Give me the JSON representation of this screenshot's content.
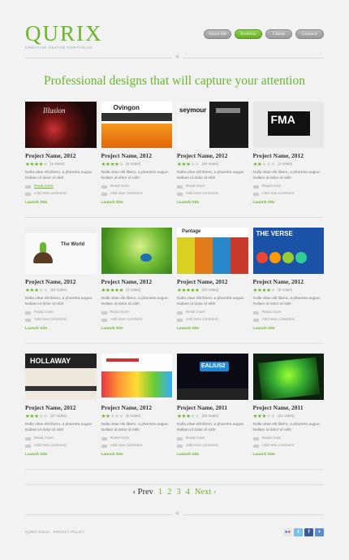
{
  "logo": {
    "name": "QURIX",
    "tagline": "CREATIVE DESIGN PORTFOLIO"
  },
  "nav": [
    {
      "label": "About Me",
      "active": false,
      "w": 34
    },
    {
      "label": "Portfolio",
      "active": true,
      "w": 34
    },
    {
      "label": "Clients",
      "active": false,
      "w": 33
    },
    {
      "label": "Contacts",
      "active": false,
      "w": 35
    }
  ],
  "headline": "Professional designs that will capture your attention",
  "projects": [
    {
      "title": "Project Name, 2012",
      "stars": 4,
      "votes": "(4 Votes)",
      "desc": "Nulla vitae elit libero, a pharetra augue. Nullam id dolor id nibh",
      "read_more": "Read more",
      "comment": "Add new comment",
      "launch": "Launch Site",
      "thumb_text": "Illusion"
    },
    {
      "title": "Project Name, 2012",
      "stars": 4,
      "votes": "(6 Votes)",
      "desc": "Nulla vitae elit libero, a pharetra augue. Nullam id dolor id nibh",
      "read_more": "Read more",
      "comment": "Add new comment",
      "launch": "Launch Site",
      "thumb_text": "Ovingon"
    },
    {
      "title": "Project Name, 2012",
      "stars": 3,
      "votes": "(39 Votes)",
      "desc": "Nulla vitae elit libero, a pharetra augue. Nullam id dolor id nibh",
      "read_more": "Read more",
      "comment": "Add new comment",
      "launch": "Launch Site",
      "thumb_text": "seymour"
    },
    {
      "title": "Project Name, 2012",
      "stars": 2,
      "votes": "(4 Votes)",
      "desc": "Nulla vitae elit libero, a pharetra augue. Nullam id dolor id nibh",
      "read_more": "Read more",
      "comment": "Add new comment",
      "launch": "Launch Site",
      "thumb_text": "FMA"
    },
    {
      "title": "Project Name, 2012",
      "stars": 3,
      "votes": "(44 Votes)",
      "desc": "Nulla vitae elit libero, a pharetra augue. Nullam id dolor id nibh",
      "read_more": "Read more",
      "comment": "Add new comment",
      "launch": "Launch Site",
      "thumb_text": "The World"
    },
    {
      "title": "Project Name, 2012",
      "stars": 5,
      "votes": "(4 Votes)",
      "desc": "Nulla vitae elit libero, a pharetra augue. Nullam id dolor id nibh",
      "read_more": "Read more",
      "comment": "Add new comment",
      "launch": "Launch Site",
      "thumb_text": ""
    },
    {
      "title": "Project Name, 2012",
      "stars": 5,
      "votes": "(23 Votes)",
      "desc": "Nulla vitae elit libero, a pharetra augue. Nullam id dolor id nibh",
      "read_more": "Read more",
      "comment": "Add new comment",
      "launch": "Launch Site",
      "thumb_text": "Pantage"
    },
    {
      "title": "Project Name, 2012",
      "stars": 4,
      "votes": "(5 Votes)",
      "desc": "Nulla vitae elit libero, a pharetra augue. Nullam id dolor id nibh",
      "read_more": "Read more",
      "comment": "Add new comment",
      "launch": "Launch Site",
      "thumb_text": "THE VERSE"
    },
    {
      "title": "Project Name, 2012",
      "stars": 3,
      "votes": "(37 Votes)",
      "desc": "Nulla vitae elit libero, a pharetra augue. Nullam id dolor id nibh",
      "read_more": "Read more",
      "comment": "Add new comment",
      "launch": "Launch Site",
      "thumb_text": "HOLLAWAY"
    },
    {
      "title": "Project Name, 2012",
      "stars": 2,
      "votes": "(6 Votes)",
      "desc": "Nulla vitae elit libero, a pharetra augue. Nullam id dolor id nibh",
      "read_more": "Read more",
      "comment": "Add new comment",
      "launch": "Launch Site",
      "thumb_text": ""
    },
    {
      "title": "Project Name, 2011",
      "stars": 3,
      "votes": "(20 Votes)",
      "desc": "Nulla vitae elit libero, a pharetra augue. Nullam id dolor id nibh",
      "read_more": "Read more",
      "comment": "Add new comment",
      "launch": "Launch Site",
      "thumb_text": "EALIUS2"
    },
    {
      "title": "Project Name, 2011",
      "stars": 3,
      "votes": "(31 Votes)",
      "desc": "Nulla vitae elit libero, a pharetra augue. Nullam id dolor id nibh",
      "read_more": "Read more",
      "comment": "Add new comment",
      "launch": "Launch Site",
      "thumb_text": ""
    }
  ],
  "pager": {
    "prev": "‹ Prev",
    "pages": [
      "1",
      "2",
      "3",
      "4"
    ],
    "next": "Next ›"
  },
  "footer": {
    "text": "QURIX ©2012 · PRIVACY POLICY"
  },
  "colors": {
    "accent": "#6ab52c"
  }
}
